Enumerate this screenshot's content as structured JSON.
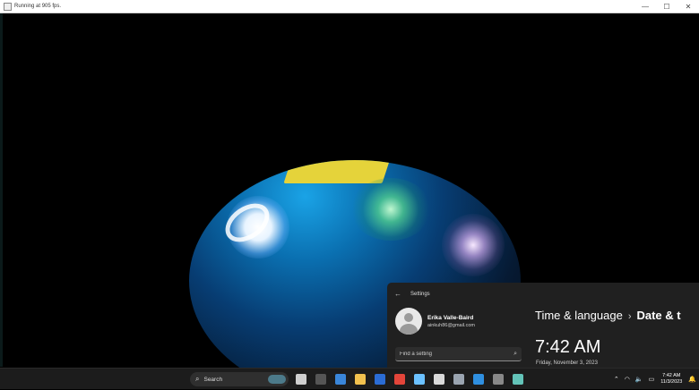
{
  "window": {
    "title": "Running at 905 fps."
  },
  "settings": {
    "app_title": "Settings",
    "user_name": "Erika Valle-Baird",
    "user_email": "ainkuh86@gmail.com",
    "search_placeholder": "Find a setting",
    "breadcrumb_parent": "Time & language",
    "breadcrumb_current": "Date & t",
    "time": "7:42 AM",
    "date": "Friday, November 3, 2023"
  },
  "taskbar": {
    "search_label": "Search",
    "clock_time": "7:42 AM",
    "clock_date": "11/3/2023",
    "pinned": [
      {
        "name": "task-view",
        "color": "#cfcfcf"
      },
      {
        "name": "terminal",
        "color": "#555555"
      },
      {
        "name": "app-a",
        "color": "#3a86d9"
      },
      {
        "name": "file-explorer",
        "color": "#f2c14e"
      },
      {
        "name": "word",
        "color": "#2b6cd4"
      },
      {
        "name": "chrome",
        "color": "#e3453a"
      },
      {
        "name": "notepad",
        "color": "#6bc1ff"
      },
      {
        "name": "snipping",
        "color": "#d9d9d9"
      },
      {
        "name": "settings",
        "color": "#9aa4b0"
      },
      {
        "name": "vscode",
        "color": "#2f8fe0"
      },
      {
        "name": "cmd",
        "color": "#888888"
      },
      {
        "name": "app-b",
        "color": "#63c3b8"
      }
    ]
  },
  "colors": {
    "accent": "#3fa9f5",
    "settings_bg": "#202020",
    "taskbar_bg": "#1c1c1c",
    "sphere_yellow": "#e5d33a"
  }
}
